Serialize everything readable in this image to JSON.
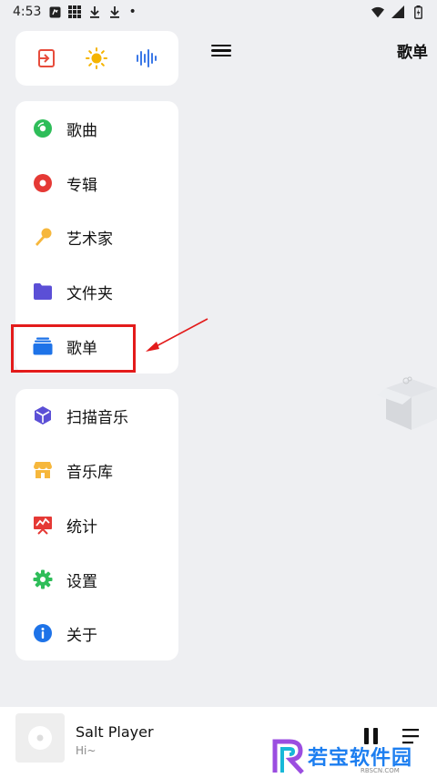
{
  "status_bar": {
    "time": "4:53",
    "dot": "•"
  },
  "header": {
    "title": "歌单"
  },
  "quick_actions": [
    {
      "icon": "exit-icon",
      "color": "#e74c3c"
    },
    {
      "icon": "sun-icon",
      "color": "#f5b400"
    },
    {
      "icon": "soundwave-icon",
      "color": "#3b78e7"
    }
  ],
  "nav_primary": [
    {
      "label": "歌曲",
      "icon": "song-disc-icon",
      "color": "#2ebd59"
    },
    {
      "label": "专辑",
      "icon": "album-disc-icon",
      "color": "#e53935"
    },
    {
      "label": "艺术家",
      "icon": "microphone-icon",
      "color": "#f6b73c"
    },
    {
      "label": "文件夹",
      "icon": "folder-icon",
      "color": "#5b4fd6"
    },
    {
      "label": "歌单",
      "icon": "playlist-icon",
      "color": "#1e73e8"
    }
  ],
  "nav_secondary": [
    {
      "label": "扫描音乐",
      "icon": "scan-icon",
      "color": "#5b4fd6"
    },
    {
      "label": "音乐库",
      "icon": "store-icon",
      "color": "#f6b73c"
    },
    {
      "label": "统计",
      "icon": "stats-icon",
      "color": "#e53935"
    },
    {
      "label": "设置",
      "icon": "settings-gear-icon",
      "color": "#2ebd59"
    },
    {
      "label": "关于",
      "icon": "info-icon",
      "color": "#1e73e8"
    }
  ],
  "player": {
    "title": "Salt Player",
    "subtitle": "Hi~"
  },
  "watermark": {
    "text": "若宝软件园",
    "sub": "RBSCN.COM"
  }
}
